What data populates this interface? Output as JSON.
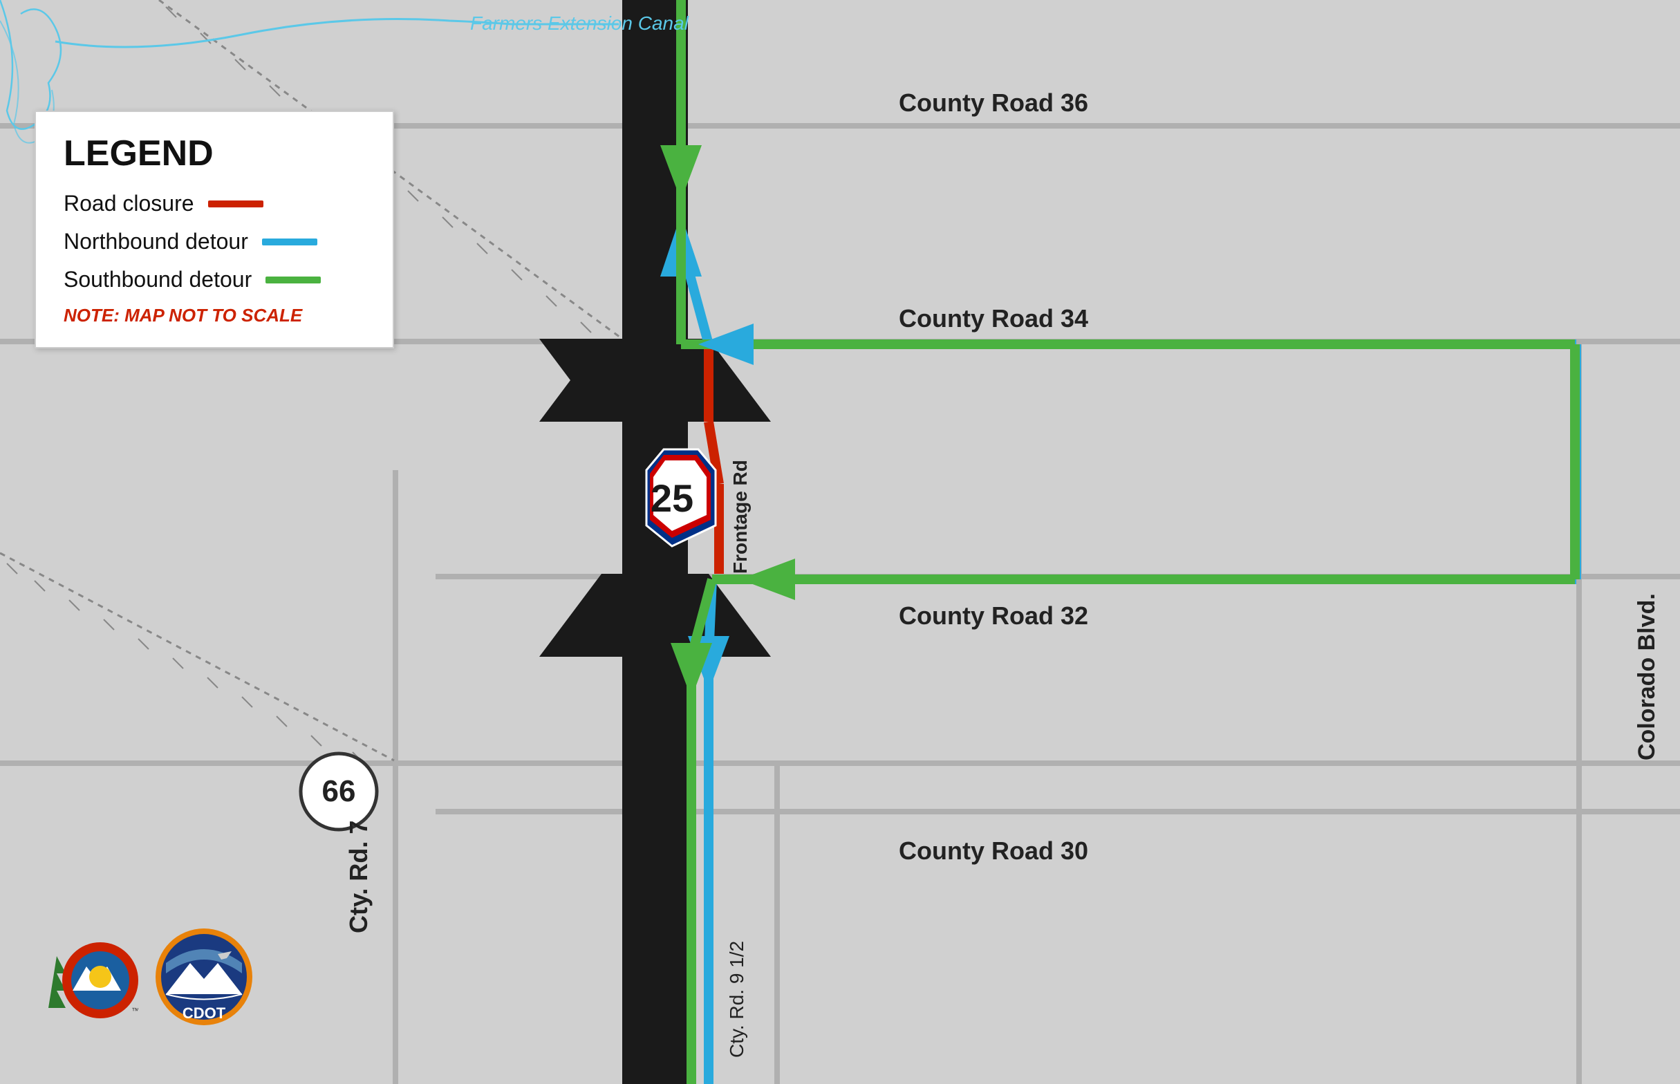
{
  "map": {
    "background_color": "#d0d0d0",
    "canal_label": "Farmers Extension Canal",
    "road_labels": {
      "county_road_36": "County Road 36",
      "county_road_34": "County Road 34",
      "county_road_32": "County Road 32",
      "county_road_30": "County Road 30",
      "cty_rd_7": "Cty. Rd. 7",
      "cty_rd_9_half": "Cty. Rd. 9 1/2",
      "frontage_rd": "Frontage Rd",
      "colorado_blvd": "Colorado Blvd.",
      "route_66": "66",
      "interstate_25": "25"
    }
  },
  "legend": {
    "title": "LEGEND",
    "items": [
      {
        "label": "Road closure",
        "color": "#cc2200"
      },
      {
        "label": "Northbound detour",
        "color": "#29aadd"
      },
      {
        "label": "Southbound detour",
        "color": "#4ab240"
      }
    ],
    "note": "NOTE: MAP NOT TO SCALE"
  },
  "colors": {
    "road_closure": "#cc2200",
    "northbound": "#29aadd",
    "southbound": "#4ab240",
    "interstate": "#1a1a1a",
    "road": "#b8b8b8",
    "canal": "#5bc8e8",
    "background": "#d0d0d0"
  }
}
